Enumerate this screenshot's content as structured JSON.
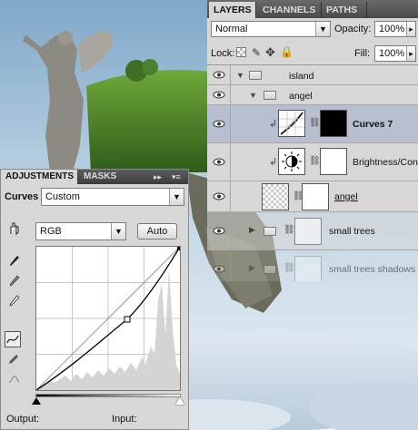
{
  "adjustments": {
    "tab_adjustments": "ADJUSTMENTS",
    "tab_masks": "MASKS",
    "ctrl_forward": "▸▸",
    "ctrl_menu": "▾≡",
    "title": "Curves",
    "preset": "Custom",
    "channel": "RGB",
    "auto_label": "Auto",
    "output_label": "Output:",
    "input_label": "Input:"
  },
  "layers": {
    "tabs": [
      "LAYERS",
      "CHANNELS",
      "PATHS"
    ],
    "blend_mode": "Normal",
    "opacity_label": "Opacity:",
    "opacity_value": "100%",
    "lock_label": "Lock:",
    "fill_label": "Fill:",
    "fill_value": "100%",
    "rows": [
      {
        "name": "island",
        "type": "group"
      },
      {
        "name": "angel",
        "type": "group"
      },
      {
        "name": "Curves 7",
        "type": "adjustment"
      },
      {
        "name": "Brightness/Cont",
        "type": "adjustment"
      },
      {
        "name": "angel",
        "type": "layer"
      },
      {
        "name": "small trees",
        "type": "group"
      },
      {
        "name": "small trees shadows",
        "type": "group"
      }
    ]
  },
  "colors": {
    "panel": "#d7d7d7",
    "selected_row": "#b7bfd0",
    "tab_bar": "#4a4a4a",
    "sky": "#9bbcd6",
    "grass": "#4f8a2a"
  },
  "icons": [
    "eye-icon",
    "folder-icon",
    "curves-adjustment-icon",
    "brightness-contrast-icon",
    "chain-link-icon",
    "clip-arrow-icon",
    "hand-target-icon",
    "eyedropper-black-icon",
    "eyedropper-gray-icon",
    "eyedropper-white-icon",
    "curve-point-tool-icon",
    "pencil-icon",
    "smooth-icon"
  ]
}
